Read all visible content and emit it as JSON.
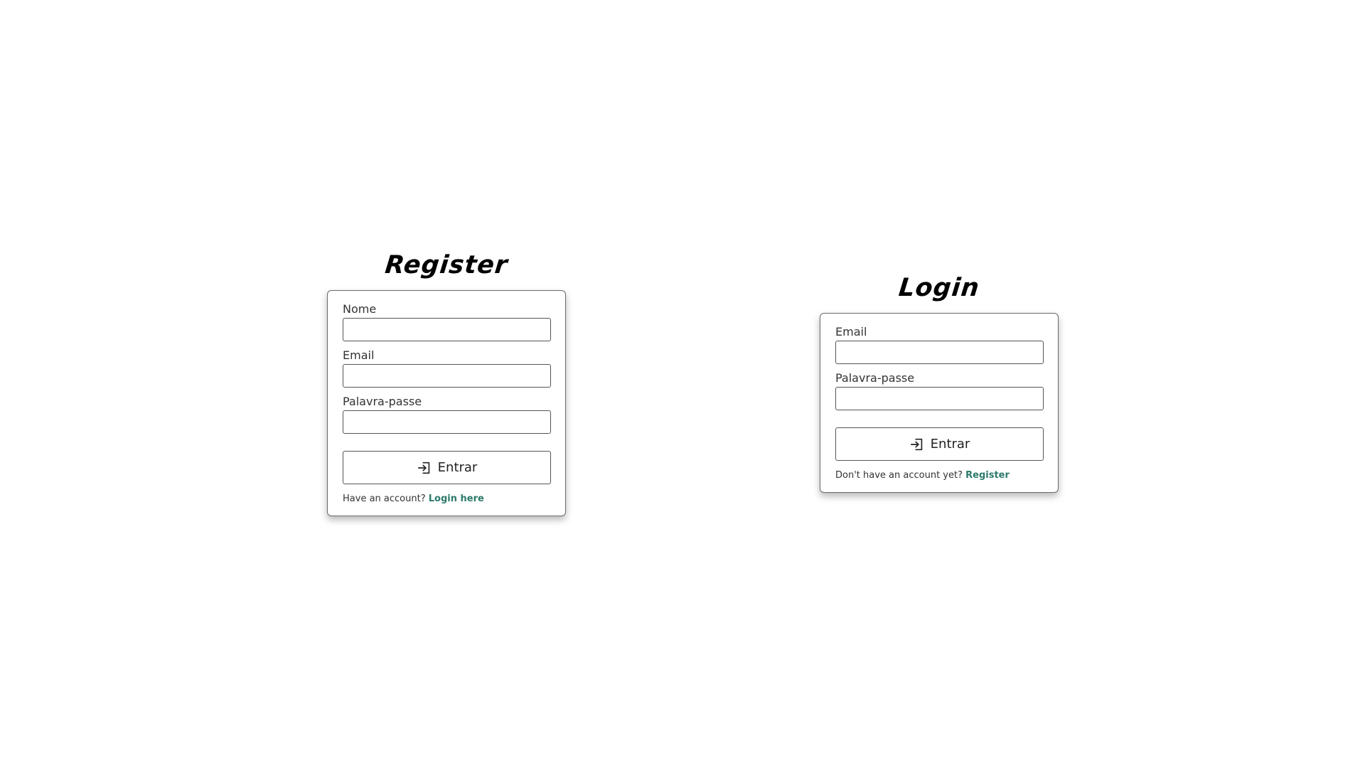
{
  "register": {
    "title": "Register",
    "fields": [
      {
        "label": "Nome",
        "value": ""
      },
      {
        "label": "Email",
        "value": ""
      },
      {
        "label": "Palavra-passe",
        "value": ""
      }
    ],
    "submit_icon": "login-arrow-icon",
    "submit_label": "Entrar",
    "footer_text": "Have an account?",
    "footer_link": "Login here"
  },
  "login": {
    "title": "Login",
    "fields": [
      {
        "label": "Email",
        "value": ""
      },
      {
        "label": "Palavra-passe",
        "value": ""
      }
    ],
    "submit_icon": "login-arrow-icon",
    "submit_label": "Entrar",
    "footer_text": "Don't have an account yet?",
    "footer_link": "Register"
  },
  "colors": {
    "link": "#2c7a6a",
    "border": "#555555",
    "title": "#000000"
  }
}
